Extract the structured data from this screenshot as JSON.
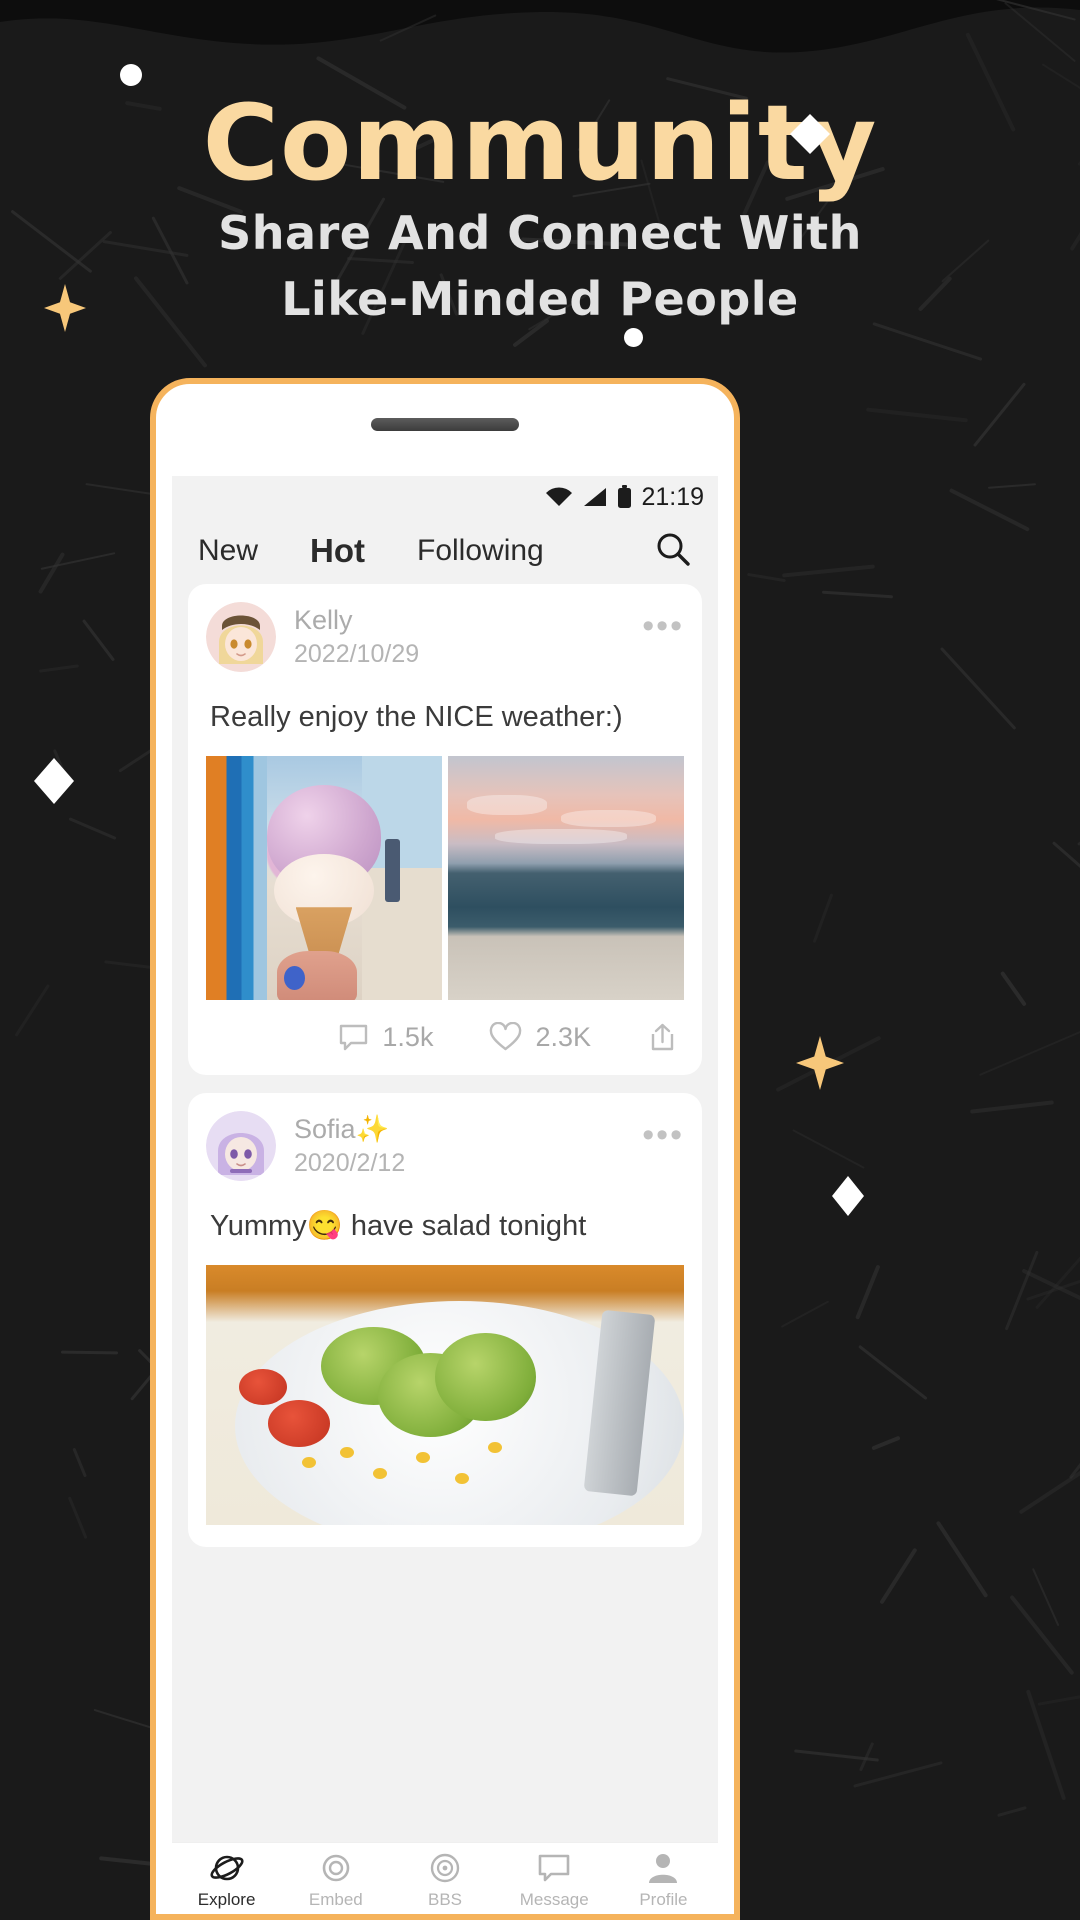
{
  "hero": {
    "title": "Community",
    "subtitle_line1": "Share And Connect With",
    "subtitle_line2": "Like-Minded People",
    "title_color": "#FAD9A1",
    "subtitle_color": "#E2E2E2",
    "background_color": "#1a1a1a",
    "accent_color": "#F5B35C"
  },
  "phone": {
    "statusbar": {
      "time": "21:19",
      "icons": [
        "wifi-icon",
        "cellular-signal-icon",
        "battery-icon"
      ]
    },
    "tabs": [
      {
        "label": "New",
        "active": false
      },
      {
        "label": "Hot",
        "active": true
      },
      {
        "label": "Following",
        "active": false
      }
    ],
    "search_icon": "search-icon",
    "posts": [
      {
        "username": "Kelly",
        "date": "2022/10/29",
        "more_label": "•••",
        "text": "Really enjoy the NICE weather:)",
        "images": [
          "ice-cream-cone-at-pier",
          "sunset-over-ocean-beach"
        ],
        "stats": {
          "comments": "1.5k",
          "likes": "2.3K",
          "comment_icon": "comment-icon",
          "like_icon": "heart-icon",
          "share_icon": "share-icon"
        }
      },
      {
        "username": "Sofia✨",
        "date": "2020/2/12",
        "more_label": "•••",
        "text": "Yummy😋 have salad tonight",
        "images": [
          "avocado-salad-plate"
        ],
        "stats": {
          "comments": "",
          "likes": "",
          "comment_icon": "comment-icon",
          "like_icon": "heart-icon",
          "share_icon": "share-icon"
        }
      }
    ],
    "bottom_nav": [
      {
        "label": "Explore",
        "icon": "planet-icon",
        "active": true
      },
      {
        "label": "Embed",
        "icon": "circle-icon",
        "active": false
      },
      {
        "label": "BBS",
        "icon": "target-icon",
        "active": false
      },
      {
        "label": "Message",
        "icon": "chat-icon",
        "active": false
      },
      {
        "label": "Profile",
        "icon": "person-icon",
        "active": false
      }
    ]
  }
}
